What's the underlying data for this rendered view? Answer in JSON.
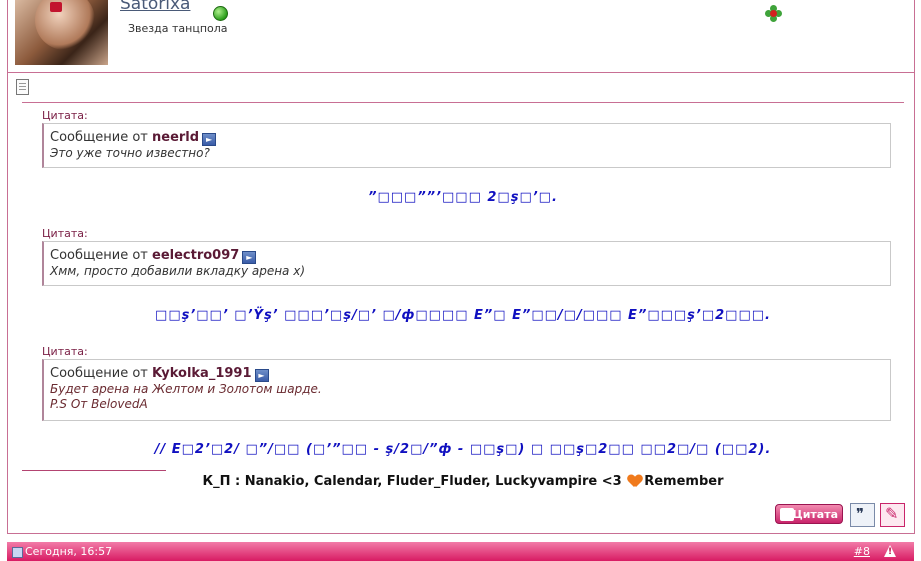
{
  "user": {
    "name": "Satorixa",
    "title": "Звезда танцпола"
  },
  "post": {
    "quotes": [
      {
        "label": "Цитата:",
        "prefix": "Сообщение от",
        "author": "neerld",
        "lines": [
          "Это уже точно известно?"
        ],
        "reply": "”□□□””’□□□ 2□ş□’□."
      },
      {
        "label": "Цитата:",
        "prefix": "Сообщение от",
        "author": "eelectro097",
        "lines": [
          "Хмм, просто добавили вкладку арена х)"
        ],
        "reply": "□□ş’□□’ □’Ÿş’ □□□’□ş/□’ □/ф□□□□ Е”□ Е”□□/□/□□□ Е”□□□ş’□2□□□."
      },
      {
        "label": "Цитата:",
        "prefix": "Сообщение от",
        "author": "Kykolka_1991",
        "lines": [
          "Будет арена на Желтом и Золотом шарде.",
          "P.S От BelovedA"
        ],
        "reply": "// Е□2’□2/ □”/□□ (□’”□□ - ş/2□/”ф - □□ş□) □ □□ş□2□□ □□2□/□ (□□2)."
      }
    ],
    "signature": {
      "text": "К_П : Nanakio, Calendar, Fluder_Fluder, Luckyvampire <3",
      "suffix": "Remember"
    },
    "buttons": {
      "quote_label": "Цитата"
    }
  },
  "footer": {
    "date": "Сегодня, 16:57",
    "post_number": "#8"
  },
  "colors": {
    "accent": "#d81b63",
    "border": "#c86f94",
    "reply_text": "#1010c0"
  }
}
